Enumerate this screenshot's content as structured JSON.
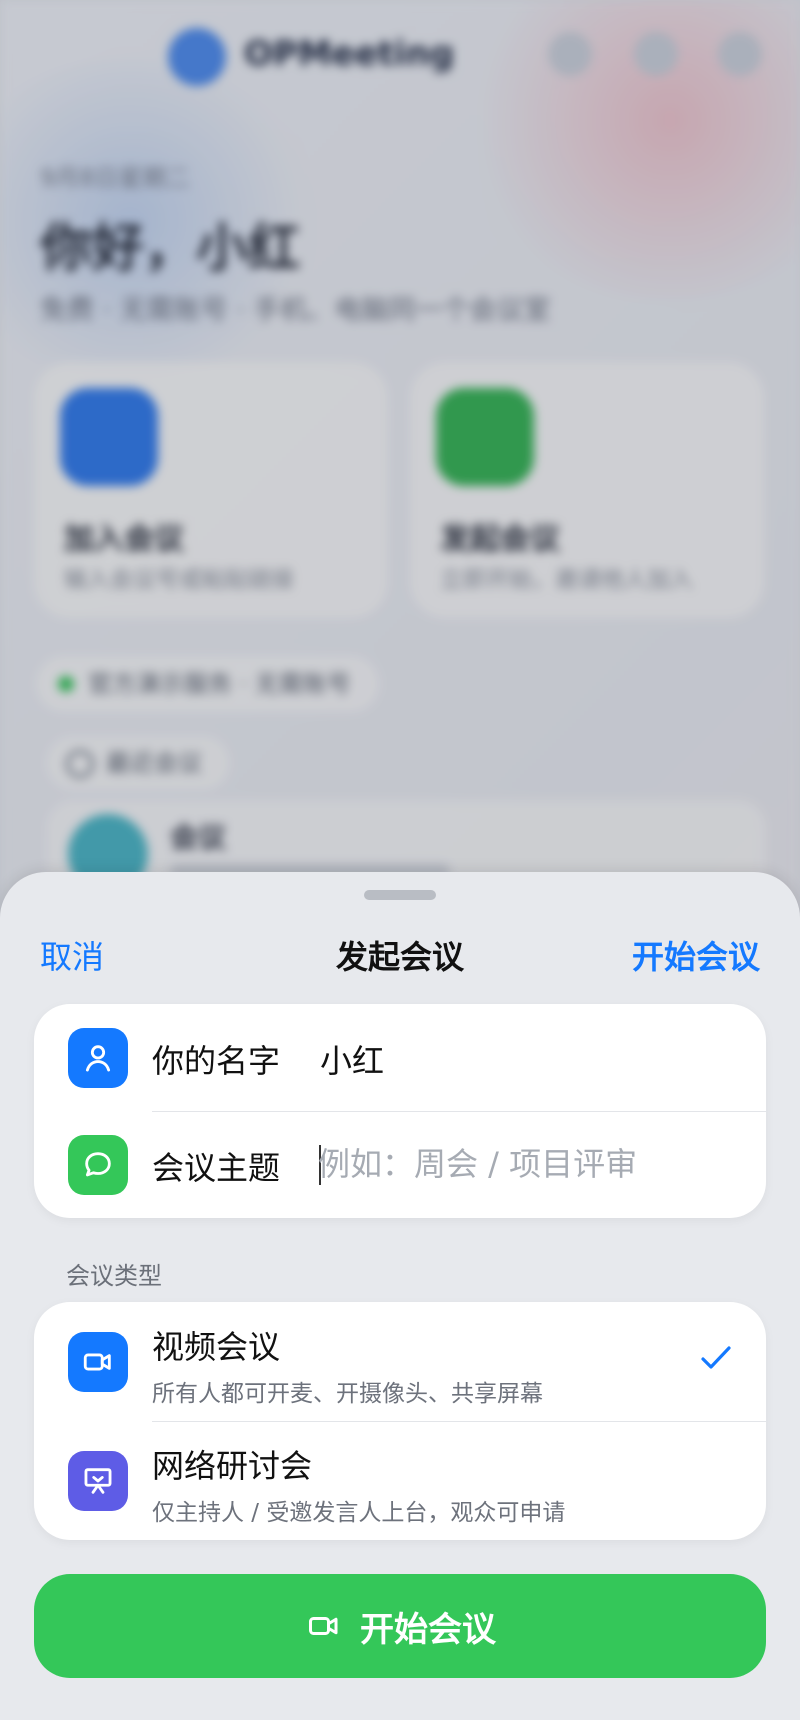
{
  "background": {
    "app_name": "OPMeeting",
    "date": "9月8日星期二",
    "greeting": "你好，小红",
    "subtitle": "免费 · 无需账号 · 手机、电脑同一个会议室",
    "cards": [
      {
        "title": "加入会议",
        "desc": "输入会议号或粘贴链接",
        "color": "#2f7bf0"
      },
      {
        "title": "发起会议",
        "desc": "立即开始，邀请他人加入",
        "color": "#34b654"
      }
    ],
    "service_status": "官方演示服务 · 无需账号",
    "recent_label": "最近会议",
    "recent_items": [
      {
        "name": "会议"
      }
    ]
  },
  "sheet": {
    "cancel_label": "取消",
    "title": "发起会议",
    "start_label": "开始会议",
    "fields": {
      "name_label": "你的名字",
      "name_value": "小红",
      "topic_label": "会议主题",
      "topic_placeholder": "例如：周会 / 项目评审"
    },
    "type_section_label": "会议类型",
    "types": [
      {
        "title": "视频会议",
        "desc": "所有人都可开麦、开摄像头、共享屏幕",
        "selected": true,
        "icon": "video-camera-icon",
        "color": "#1479ff"
      },
      {
        "title": "网络研讨会",
        "desc": "仅主持人 / 受邀发言人上台，观众可申请",
        "selected": false,
        "icon": "presentation-icon",
        "color": "#5e5ce6"
      }
    ],
    "cta_label": "开始会议"
  },
  "colors": {
    "accent": "#1479ff",
    "green": "#34c759",
    "purple": "#5e5ce6"
  }
}
